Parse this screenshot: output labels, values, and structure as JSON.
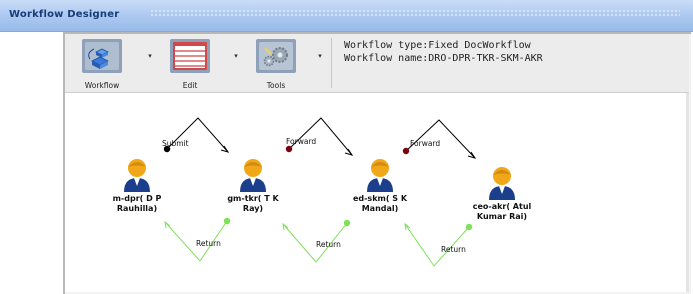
{
  "window": {
    "title": "Workflow Designer"
  },
  "toolbar": {
    "buttons": [
      {
        "label": "Workflow",
        "icon": "workflow-blocks-icon"
      },
      {
        "label": "Edit",
        "icon": "edit-form-icon"
      },
      {
        "label": "Tools",
        "icon": "tools-gears-icon"
      }
    ],
    "dropdown_glyph": "▾",
    "info": {
      "type_line": "Workflow type:Fixed DocWorkflow",
      "name_line": "Workflow name:DRO-DPR-TKR-SKM-AKR"
    }
  },
  "workflow": {
    "nodes": [
      {
        "line1": "m-dpr( D P",
        "line2": "Rauhilla)"
      },
      {
        "line1": "gm-tkr( T K",
        "line2": "Ray)"
      },
      {
        "line1": "ed-skm( S K",
        "line2": "Mandal)"
      },
      {
        "line1": "ceo-akr( Atul",
        "line2": "Kumar Rai)"
      }
    ],
    "forward_edges": [
      {
        "label": "Submit"
      },
      {
        "label": "Forward"
      },
      {
        "label": "Forward"
      }
    ],
    "return_edges": [
      {
        "label": "Return"
      },
      {
        "label": "Return"
      },
      {
        "label": "Return"
      }
    ]
  },
  "colors": {
    "titlebar": "#a9c6ef",
    "title_text": "#163c7a",
    "forward_line": "#000000",
    "submit_dot": "#000000",
    "forward_dot": "#7a0010",
    "return_line": "#7fe05a",
    "user_head": "#f0a818",
    "user_body": "#1b3f8c"
  }
}
